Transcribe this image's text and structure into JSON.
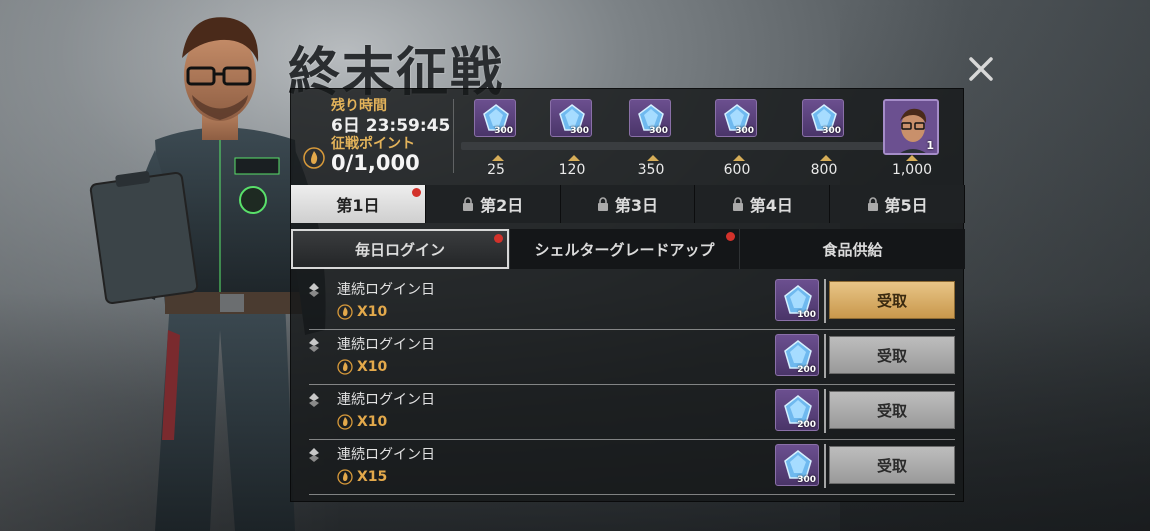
{
  "event": {
    "title": "終末征戦",
    "timer_label": "残り時間",
    "timer_value": "6日 23:59:45",
    "points_label": "征戦ポイント",
    "points_value": "0/1,000"
  },
  "milestones": [
    {
      "threshold": "25",
      "reward_qty": "300",
      "reward_icon": "gem-icon"
    },
    {
      "threshold": "120",
      "reward_qty": "300",
      "reward_icon": "gem-icon"
    },
    {
      "threshold": "350",
      "reward_qty": "300",
      "reward_icon": "gem-icon"
    },
    {
      "threshold": "600",
      "reward_qty": "300",
      "reward_icon": "gem-icon"
    },
    {
      "threshold": "800",
      "reward_qty": "300",
      "reward_icon": "gem-icon"
    },
    {
      "threshold": "1,000",
      "reward_qty": "1",
      "reward_icon": "hero-avatar-icon"
    }
  ],
  "day_tabs": [
    {
      "label": "第1日",
      "locked": false,
      "active": true,
      "badge": true
    },
    {
      "label": "第2日",
      "locked": true,
      "active": false,
      "badge": false
    },
    {
      "label": "第3日",
      "locked": true,
      "active": false,
      "badge": false
    },
    {
      "label": "第4日",
      "locked": true,
      "active": false,
      "badge": false
    },
    {
      "label": "第5日",
      "locked": true,
      "active": false,
      "badge": false
    }
  ],
  "sub_tabs": [
    {
      "label": "毎日ログイン",
      "active": true,
      "badge": true
    },
    {
      "label": "シェルターグレードアップ",
      "active": false,
      "badge": true
    },
    {
      "label": "食品供給",
      "active": false,
      "badge": false
    }
  ],
  "tasks": [
    {
      "title": "連続ログイン日",
      "multiplier": "X10",
      "reward_qty": "100",
      "claim_label": "受取",
      "claimable": true
    },
    {
      "title": "連続ログイン日",
      "multiplier": "X10",
      "reward_qty": "200",
      "claim_label": "受取",
      "claimable": false
    },
    {
      "title": "連続ログイン日",
      "multiplier": "X10",
      "reward_qty": "200",
      "claim_label": "受取",
      "claimable": false
    },
    {
      "title": "連続ログイン日",
      "multiplier": "X15",
      "reward_qty": "300",
      "claim_label": "受取",
      "claimable": false
    }
  ],
  "colors": {
    "accent_gold": "#e3b35a",
    "claim_active": "#d9ae6a",
    "claim_inactive": "#adadad",
    "badge_red": "#d3322b"
  }
}
